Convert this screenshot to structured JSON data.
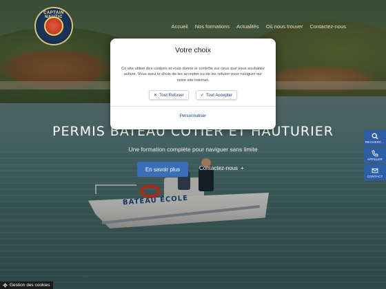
{
  "brand": {
    "logo_text": "CAPTAIN NAUTIC"
  },
  "nav": {
    "items": [
      {
        "label": "Accueil"
      },
      {
        "label": "Nos formations"
      },
      {
        "label": "Actualités"
      },
      {
        "label": "Où nous trouver"
      },
      {
        "label": "Contactez-nous"
      }
    ]
  },
  "hero": {
    "title": "PERMIS BATEAU CÔTIER ET HAUTURIER",
    "subtitle": "Une formation complète pour naviguer sans limite",
    "cta_primary": "En savoir plus",
    "cta_secondary": "Contactez-nous",
    "cta_secondary_icon": "+",
    "boat_text": "BATEAU ÉCOLE"
  },
  "sidetools": [
    {
      "label": "RECHERC...",
      "icon": "search-icon"
    },
    {
      "label": "APPELER",
      "icon": "phone-icon"
    },
    {
      "label": "CONTACT",
      "icon": "mail-icon"
    }
  ],
  "cookie_modal": {
    "title": "Votre choix",
    "text": "Ce site utilise des cookies et vous donne le contrôle sur ceux que vous souhaitez activer. Vous avez le choix de les accepter ou de les refuser pour naviguer sur notre site internet.",
    "refuse_label": "Tout Refuser",
    "accept_label": "Tout Accepter",
    "custom_label": "Personnaliser"
  },
  "cookie_manager": {
    "label": "Gestion des cookies"
  },
  "colors": {
    "accent": "#2e5da8",
    "cta": "#3a6fb8",
    "modal_link": "#1b3e7a"
  }
}
